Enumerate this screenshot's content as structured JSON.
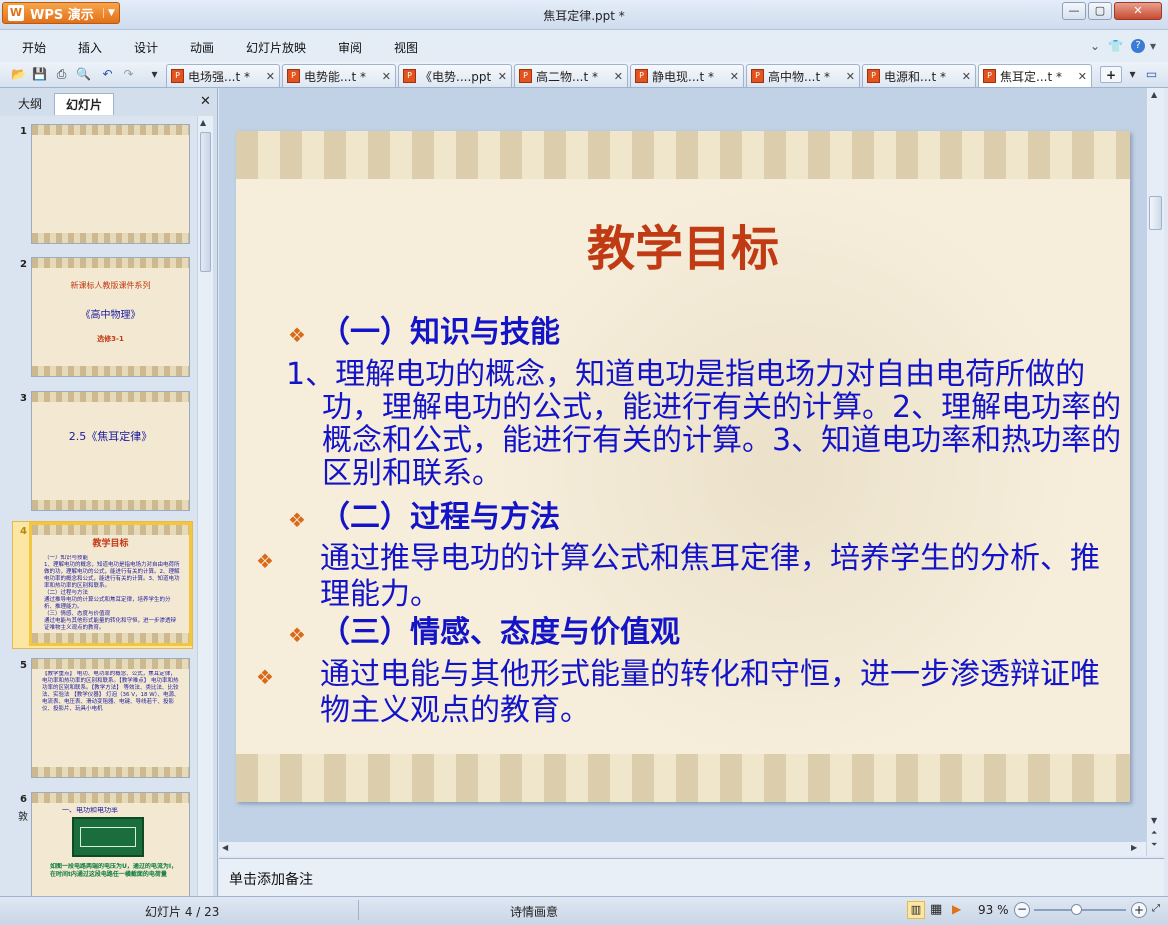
{
  "app": {
    "name": "WPS 演示",
    "doc_title": "焦耳定律.ppt *"
  },
  "menu": [
    "开始",
    "插入",
    "设计",
    "动画",
    "幻灯片放映",
    "审阅",
    "视图"
  ],
  "tabs": [
    {
      "label": "电场强...t *"
    },
    {
      "label": "电势能...t *"
    },
    {
      "label": "《电势....ppt"
    },
    {
      "label": "高二物...t *"
    },
    {
      "label": "静电现...t *"
    },
    {
      "label": "高中物...t *"
    },
    {
      "label": "电源和...t *"
    },
    {
      "label": "焦耳定...t *"
    }
  ],
  "panel": {
    "tab_outline": "大纲",
    "tab_slides": "幻灯片"
  },
  "thumbs": [
    {
      "num": "1"
    },
    {
      "num": "2",
      "line1": "新课标人教版课件系列",
      "line2": "《高中物理》",
      "line3": "选修3-1"
    },
    {
      "num": "3",
      "line1": "2.5《焦耳定律》"
    },
    {
      "num": "4",
      "title": "教学目标"
    },
    {
      "num": "5",
      "text": "【教学重点】 电功、电功率的概念、公式，焦耳定律，电功率和热功率的区别和联系。【教学难点】 电功率和热功率的区别和联系。【教学方法】 等效法、类比法、比较法、实验法 【教学仪器】 灯泡（36 V，18 W）、电源、电流表、电压表、滑动变阻器、电键、导线若干、投影仪、投影片、玩具小电机"
    },
    {
      "num": "6",
      "side": "敦",
      "text1": "一、电功和电功率",
      "text2": "如图一段电路两端的电压为U，通过的电流为I，在时间t内通过这段电路任一横截面的电荷量"
    }
  ],
  "slide": {
    "title": "教学目标",
    "h1": "（一）知识与技能",
    "p1": "1、理解电功的概念，知道电功是指电场力对自由电荷所做的功，理解电功的公式，能进行有关的计算。2、理解电功率的概念和公式，能进行有关的计算。3、知道电功率和热功率的区别和联系。",
    "h2": "（二）过程与方法",
    "p2": "通过推导电功的计算公式和焦耳定律，培养学生的分析、推理能力。",
    "h3": "（三）情感、态度与价值观",
    "p3": "通过电能与其他形式能量的转化和守恒，进一步渗透辩证唯物主义观点的教育。"
  },
  "notes": {
    "placeholder": "单击添加备注"
  },
  "status": {
    "slide_pos": "幻灯片 4 / 23",
    "theme": "诗情画意",
    "zoom": "93 %"
  },
  "colors": {
    "title": "#c03a14",
    "body": "#1313c8",
    "bullet": "#d86b1a",
    "accent": "#e2701a"
  }
}
